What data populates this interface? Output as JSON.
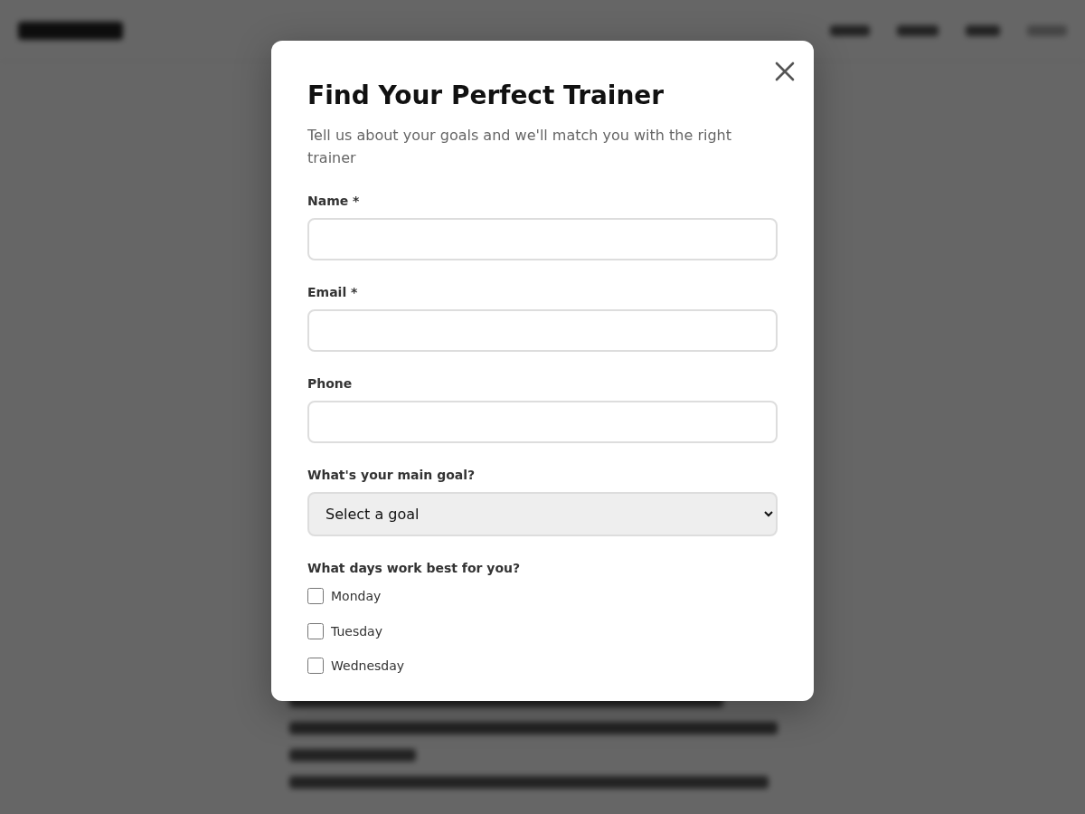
{
  "modal": {
    "title": "Find Your Perfect Trainer",
    "subtitle": "Tell us about your goals and we'll match you with the right trainer",
    "fields": [
      {
        "kind": "text",
        "label": "Name *"
      },
      {
        "kind": "text",
        "label": "Email *"
      },
      {
        "kind": "text",
        "label": "Phone"
      },
      {
        "kind": "select",
        "label": "What's your main goal?",
        "value": "Select a goal"
      }
    ],
    "days_label": "What days work best for you?",
    "days": [
      {
        "label": "Monday",
        "checked": false
      },
      {
        "label": "Tuesday",
        "checked": false
      },
      {
        "label": "Wednesday",
        "checked": false
      }
    ]
  }
}
